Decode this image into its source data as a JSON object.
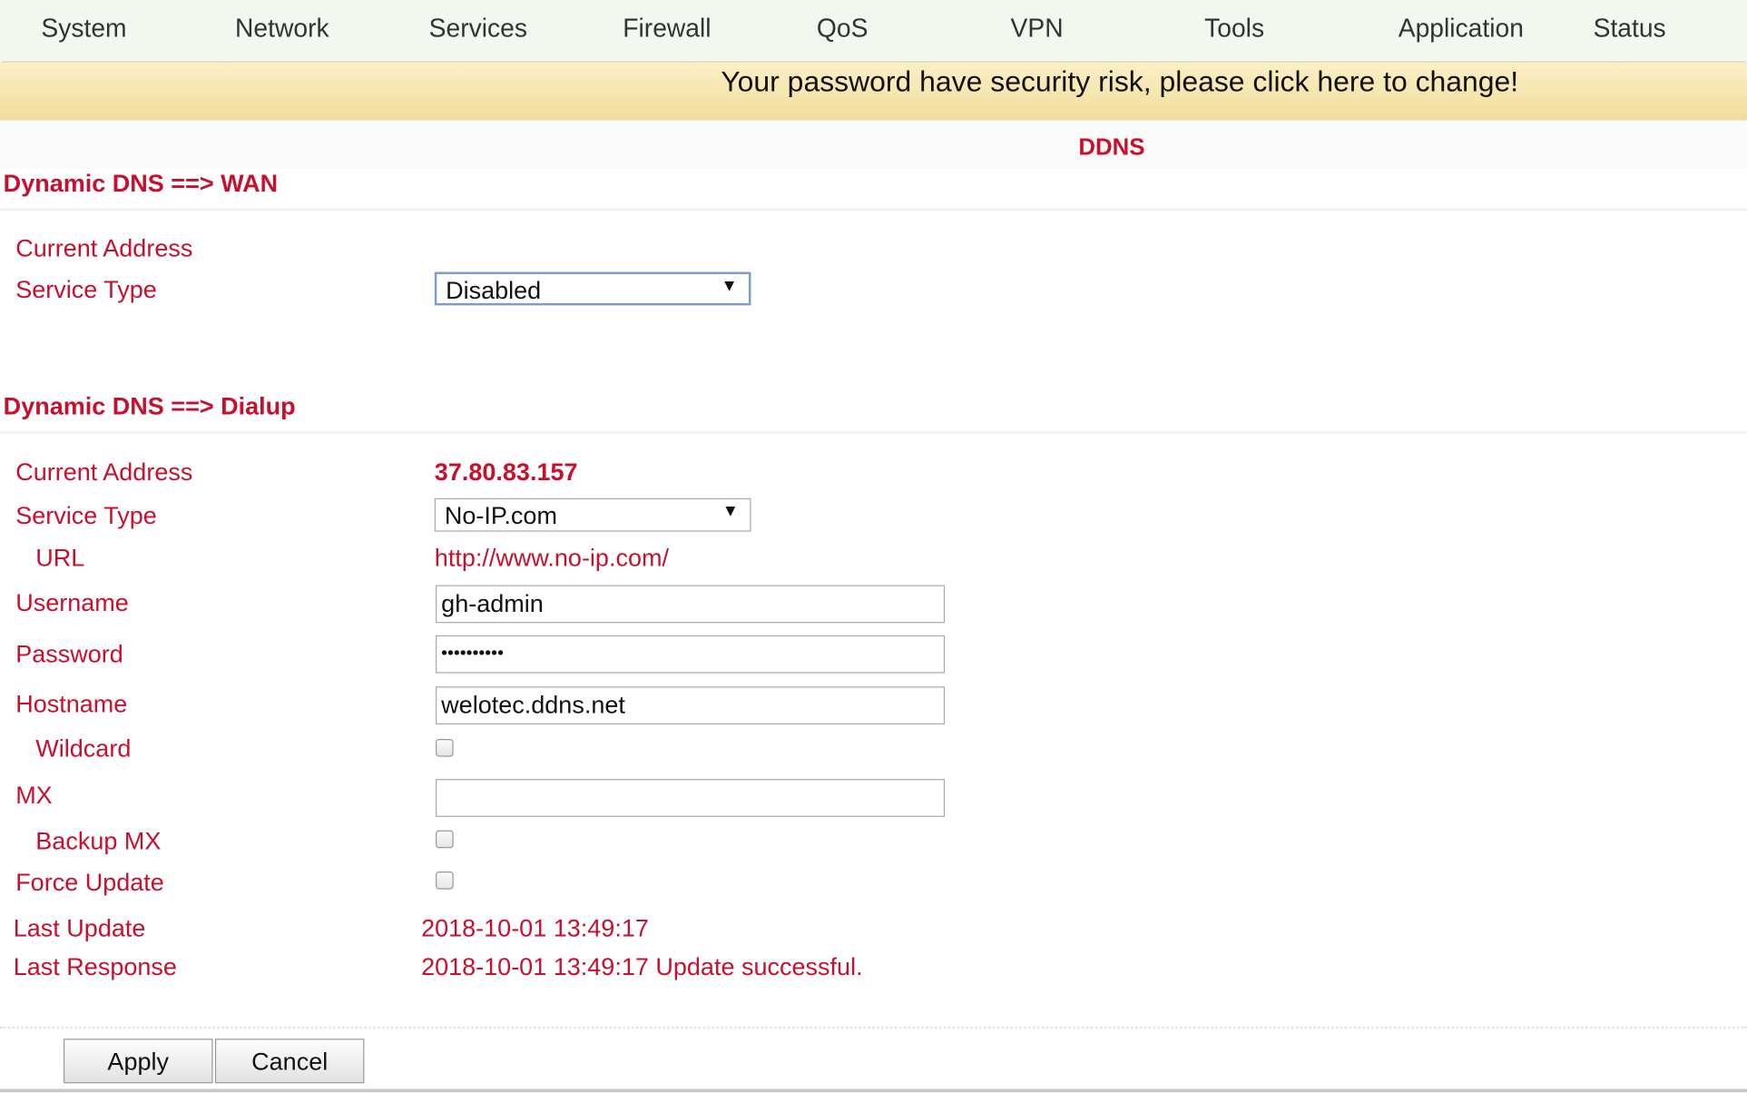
{
  "nav": [
    "System",
    "Network",
    "Services",
    "Firewall",
    "QoS",
    "VPN",
    "Tools",
    "Application",
    "Status"
  ],
  "banner": "Your password have security risk, please click here to change!",
  "page_title": "DDNS",
  "wan": {
    "heading": "Dynamic DNS ==> WAN",
    "current_address_label": "Current Address",
    "service_type_label": "Service Type",
    "service_type_value": "Disabled"
  },
  "dialup": {
    "heading": "Dynamic DNS ==> Dialup",
    "current_address_label": "Current Address",
    "current_address_value": "37.80.83.157",
    "service_type_label": "Service Type",
    "service_type_value": "No-IP.com",
    "url_label": "URL",
    "url_value": "http://www.no-ip.com/",
    "username_label": "Username",
    "username_value": "gh-admin",
    "password_label": "Password",
    "password_value": "••••••••••",
    "hostname_label": "Hostname",
    "hostname_value": "welotec.ddns.net",
    "wildcard_label": "Wildcard",
    "wildcard_checked": false,
    "mx_label": "MX",
    "mx_value": "",
    "backup_mx_label": "Backup MX",
    "backup_mx_checked": false,
    "force_update_label": "Force Update",
    "force_update_checked": false,
    "last_update_label": "Last Update",
    "last_update_value": "2018-10-01 13:49:17",
    "last_response_label": "Last Response",
    "last_response_value": "2018-10-01 13:49:17 Update successful."
  },
  "buttons": {
    "apply": "Apply",
    "cancel": "Cancel"
  },
  "colors": {
    "accent": "#c8102e",
    "nav_bg": "#f2f7ef",
    "banner_bg": "#f5e3a8"
  }
}
